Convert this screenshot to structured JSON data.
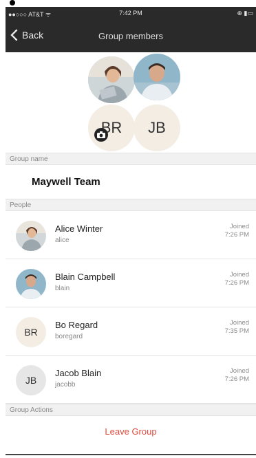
{
  "status_bar": {
    "carrier": "●●○○○ AT&T ᯤ",
    "time": "7:42 PM",
    "battery": "⊕ ▮▭"
  },
  "nav": {
    "back_label": "Back",
    "title": "Group members"
  },
  "header": {
    "initials": [
      "BR",
      "JB"
    ]
  },
  "sections": {
    "group_name_label": "Group name",
    "people_label": "People",
    "actions_label": "Group Actions"
  },
  "group": {
    "name": "Maywell Team"
  },
  "members": [
    {
      "name": "Alice Winter",
      "username": "alice",
      "joined_label": "Joined",
      "joined_time": "7:26 PM"
    },
    {
      "name": "Blain Campbell",
      "username": "blain",
      "joined_label": "Joined",
      "joined_time": "7:26 PM"
    },
    {
      "name": "Bo Regard",
      "username": "boregard",
      "initials": "BR",
      "joined_label": "Joined",
      "joined_time": "7:35 PM"
    },
    {
      "name": "Jacob Blain",
      "username": "jacobb",
      "initials": "JB",
      "joined_label": "Joined",
      "joined_time": "7:26 PM"
    }
  ],
  "actions": {
    "leave_group": "Leave Group"
  },
  "colors": {
    "nav_bg": "#2a2a2a",
    "leave_red": "#e04a3a",
    "initials_bg_br": "#f3ede4",
    "initials_bg_jb": "#e6e6e6"
  }
}
